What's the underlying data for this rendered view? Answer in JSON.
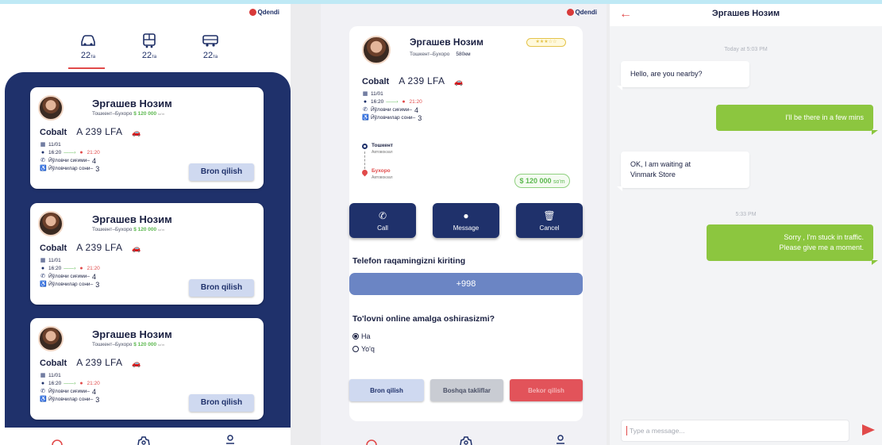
{
  "logo_text": "Qdendi",
  "screen1": {
    "tabs": [
      {
        "icon": "car-icon",
        "count": "22",
        "unit": "та"
      },
      {
        "icon": "bus-icon",
        "count": "22",
        "unit": "та"
      },
      {
        "icon": "minibus-icon",
        "count": "22",
        "unit": "та"
      }
    ],
    "cards": [
      {
        "name": "Эргашев Нозим",
        "route": "Тошкент–Бухоро",
        "price": "$ 120 000",
        "price_unit": "so'm",
        "car_model": "Cobalt",
        "plate": "A 239 LFA",
        "date": "11/01",
        "depart": "16:20",
        "arrive": "21:20",
        "seats_label": "Йўловчи сиғими–",
        "seats": "4",
        "passengers_label": "Йўловчилар сони–",
        "passengers": "3",
        "button": "Bron qilish"
      },
      {
        "name": "Эргашев Нозим",
        "route": "Тошкент–Бухоро",
        "price": "$ 120 000",
        "price_unit": "so'm",
        "car_model": "Cobalt",
        "plate": "A 239 LFA",
        "date": "11/01",
        "depart": "16:20",
        "arrive": "21:20",
        "seats_label": "Йўловчи сиғими–",
        "seats": "4",
        "passengers_label": "Йўловчилар сони–",
        "passengers": "3",
        "button": "Bron qilish"
      },
      {
        "name": "Эргашев Нозим",
        "route": "Тошкент–Бухоро",
        "price": "$ 120 000",
        "price_unit": "so'm",
        "car_model": "Cobalt",
        "plate": "A 239 LFA",
        "date": "11/01",
        "depart": "16:20",
        "arrive": "21:20",
        "seats_label": "Йўловчи сиғими–",
        "seats": "4",
        "passengers_label": "Йўловчилар сони–",
        "passengers": "3",
        "button": "Bron qilish"
      }
    ]
  },
  "screen2": {
    "name": "Эргашев Нозим",
    "rating": "★★★☆☆",
    "route": "Тошкент–Бухоро",
    "distance": "580км",
    "car_model": "Cobalt",
    "plate": "A 239 LFA",
    "date": "11/01",
    "depart": "16:20",
    "arrive": "21:20",
    "seats_label": "Йўловчи сиғими–",
    "seats": "4",
    "passengers_label": "Йўловчилар сони–",
    "passengers": "3",
    "from_city": "Тошкент",
    "from_sub": "Автовокзал",
    "to_city": "Бухоро",
    "to_sub": "Автовокзал",
    "price": "$ 120 000",
    "price_unit": "so'm",
    "actions": {
      "call": "Call",
      "message": "Message",
      "cancel": "Cancel"
    },
    "phone_prompt": "Telefon raqamingizni kiriting",
    "phone_value": "+998",
    "payment_question": "To'lovni online amalga oshirasizmi?",
    "option_yes": "Ha",
    "option_no": "Yo'q",
    "btn_book": "Bron qilish",
    "btn_other": "Boshqa takliflar",
    "btn_cancel": "Bekor qilish"
  },
  "screen3": {
    "title": "Эргашев Нозим",
    "time1": "Today at 5:03 PM",
    "msg1": "Hello, are you nearby?",
    "msg2": "I'll be there in a few mins",
    "msg3a": "OK, I am waiting at",
    "msg3b": "Vinmark Store",
    "time2": "5:33 PM",
    "msg4a": "Sorry , I'm stuck in traffic.",
    "msg4b": "Please give me a moment.",
    "composer_placeholder": "Type a message..."
  },
  "colors": {
    "navy": "#1f316b",
    "accent_red": "#e14a4a",
    "green": "#8cc63f",
    "phone_blue": "#6b85c4"
  }
}
